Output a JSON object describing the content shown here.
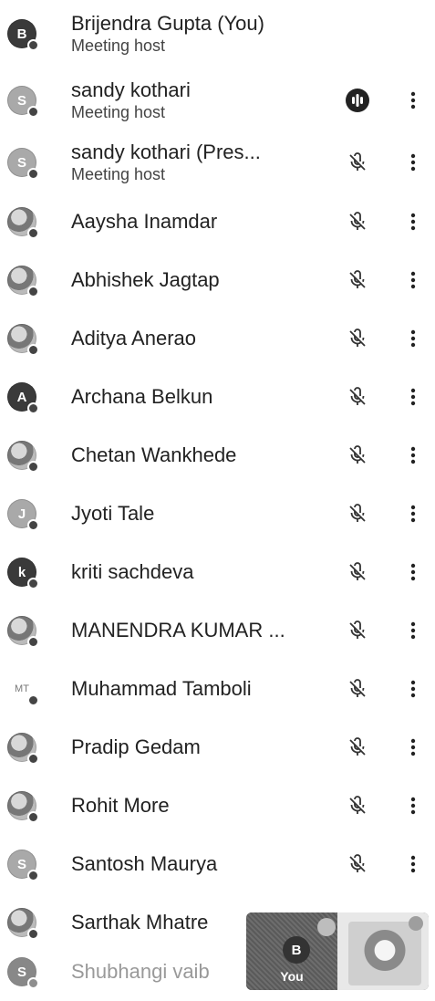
{
  "participants": [
    {
      "name": "Brijendra Gupta (You)",
      "role": "Meeting host",
      "avatar": "B",
      "avatar_style": "dark",
      "mic": "none"
    },
    {
      "name": "sandy kothari",
      "role": "Meeting host",
      "avatar": "S",
      "avatar_style": "light",
      "mic": "talking-icon"
    },
    {
      "name": "sandy kothari (Pres...",
      "role": "Meeting host",
      "avatar": "S",
      "avatar_style": "light",
      "mic": "mic-off-icon"
    },
    {
      "name": "Aaysha Inamdar",
      "role": "",
      "avatar": "",
      "avatar_style": "photo",
      "mic": "mic-off-icon"
    },
    {
      "name": "Abhishek Jagtap",
      "role": "",
      "avatar": "",
      "avatar_style": "photo",
      "mic": "mic-off-icon"
    },
    {
      "name": "Aditya Anerao",
      "role": "",
      "avatar": "",
      "avatar_style": "photo",
      "mic": "mic-off-icon"
    },
    {
      "name": "Archana Belkun",
      "role": "",
      "avatar": "A",
      "avatar_style": "dark",
      "mic": "mic-off-icon"
    },
    {
      "name": "Chetan Wankhede",
      "role": "",
      "avatar": "",
      "avatar_style": "photo",
      "mic": "mic-off-icon"
    },
    {
      "name": "Jyoti Tale",
      "role": "",
      "avatar": "J",
      "avatar_style": "light",
      "mic": "mic-off-icon"
    },
    {
      "name": "kriti sachdeva",
      "role": "",
      "avatar": "k",
      "avatar_style": "dark",
      "mic": "mic-off-icon"
    },
    {
      "name": "MANENDRA KUMAR ...",
      "role": "",
      "avatar": "",
      "avatar_style": "photo",
      "mic": "mic-off-icon"
    },
    {
      "name": "Muhammad Tamboli",
      "role": "",
      "avatar": "MT",
      "avatar_style": "text",
      "mic": "mic-off-icon"
    },
    {
      "name": "Pradip Gedam",
      "role": "",
      "avatar": "",
      "avatar_style": "photo",
      "mic": "mic-off-icon"
    },
    {
      "name": "Rohit More",
      "role": "",
      "avatar": "",
      "avatar_style": "photo",
      "mic": "mic-off-icon"
    },
    {
      "name": "Santosh Maurya",
      "role": "",
      "avatar": "S",
      "avatar_style": "light",
      "mic": "mic-off-icon"
    },
    {
      "name": "Sarthak Mhatre",
      "role": "",
      "avatar": "",
      "avatar_style": "photo",
      "mic": "none"
    },
    {
      "name": "Shubhangi vaib",
      "role": "",
      "avatar": "S",
      "avatar_style": "dark",
      "mic": "none",
      "faded": true
    }
  ],
  "self_view": {
    "avatar": "B",
    "label": "You"
  }
}
